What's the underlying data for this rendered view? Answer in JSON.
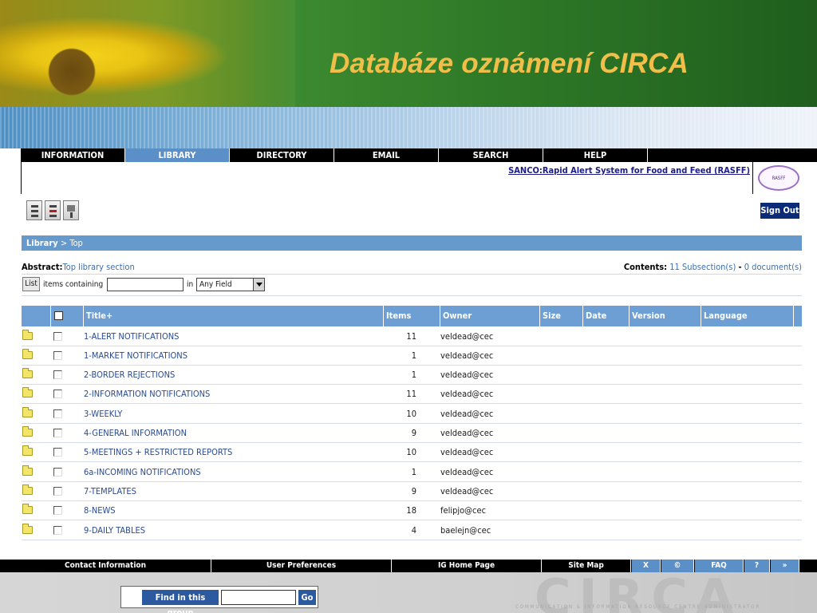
{
  "slide": {
    "title": "Databáze oznámení CIRCA"
  },
  "nav": {
    "tabs": [
      {
        "label": "INFORMATION"
      },
      {
        "label": "LIBRARY"
      },
      {
        "label": "DIRECTORY"
      },
      {
        "label": "EMAIL"
      },
      {
        "label": "SEARCH"
      },
      {
        "label": "HELP"
      }
    ]
  },
  "header": {
    "interest_group_link": "SANCO:Rapid Alert System for Food and Feed (RASFF)",
    "sign_out": "Sign Out"
  },
  "breadcrumb": {
    "root": "Library",
    "separator": ">",
    "current": "Top"
  },
  "abstract": {
    "label": "Abstract:",
    "value": "Top library section"
  },
  "contents": {
    "label": "Contents:",
    "subsections": "11 Subsection(s)",
    "dash": "-",
    "documents": "0 document(s)"
  },
  "search": {
    "list_button": "List",
    "items_containing": "items containing",
    "query_value": "",
    "in_label": "in",
    "field_selected": "Any Field"
  },
  "table": {
    "headers": {
      "title": "Title+",
      "items": "Items",
      "owner": "Owner",
      "size": "Size",
      "date": "Date",
      "version": "Version",
      "language": "Language"
    },
    "rows": [
      {
        "title": "1-ALERT NOTIFICATIONS",
        "items": "11",
        "owner": "veldead@cec"
      },
      {
        "title": "1-MARKET NOTIFICATIONS",
        "items": "1",
        "owner": "veldead@cec"
      },
      {
        "title": "2-BORDER REJECTIONS",
        "items": "1",
        "owner": "veldead@cec"
      },
      {
        "title": "2-INFORMATION NOTIFICATIONS",
        "items": "11",
        "owner": "veldead@cec"
      },
      {
        "title": "3-WEEKLY",
        "items": "10",
        "owner": "veldead@cec"
      },
      {
        "title": "4-GENERAL INFORMATION",
        "items": "9",
        "owner": "veldead@cec"
      },
      {
        "title": "5-MEETINGS + RESTRICTED REPORTS",
        "items": "10",
        "owner": "veldead@cec"
      },
      {
        "title": "6a-INCOMING NOTIFICATIONS",
        "items": "1",
        "owner": "veldead@cec"
      },
      {
        "title": "7-TEMPLATES",
        "items": "9",
        "owner": "veldead@cec"
      },
      {
        "title": "8-NEWS",
        "items": "18",
        "owner": "felipjo@cec"
      },
      {
        "title": "9-DAILY TABLES",
        "items": "4",
        "owner": "baelejn@cec"
      }
    ]
  },
  "footer": {
    "contact": "Contact Information",
    "prefs": "User Preferences",
    "ig_home": "IG Home Page",
    "sitemap": "Site Map",
    "x": "X",
    "copyright": "©",
    "faq": "FAQ",
    "help": "?",
    "more": "»"
  },
  "find": {
    "label": "Find in this group",
    "value": "",
    "go": "Go"
  },
  "watermark": {
    "mark": "CIRCA",
    "tagline": "COMMUNICATION & INFORMATION RESOURCE CENTRE ADMINISTRATOR"
  },
  "colors": {
    "nav_active": "#5b8fc8",
    "table_header": "#6d9fd4",
    "title_gold": "#f2be4a",
    "link_blue": "#2a4a90"
  }
}
